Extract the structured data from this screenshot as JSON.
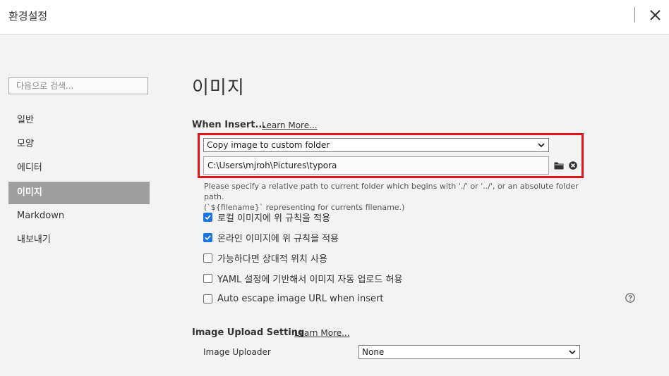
{
  "window": {
    "title": "환경설정"
  },
  "sidebar": {
    "search_placeholder": "다음으로 검색...",
    "items": [
      {
        "label": "일반",
        "active": false
      },
      {
        "label": "모양",
        "active": false
      },
      {
        "label": "에디터",
        "active": false
      },
      {
        "label": "이미지",
        "active": true
      },
      {
        "label": "Markdown",
        "active": false
      },
      {
        "label": "내보내기",
        "active": false
      }
    ]
  },
  "main": {
    "title": "이미지",
    "when_insert": {
      "label": "When Insert...",
      "learn_more": "Learn More...",
      "select_value": "Copy image to custom folder",
      "path_value": "C:\\Users\\mjroh\\Pictures\\typora",
      "hint_line1": "Please specify a relative path to current folder which begins with './' or '../', or an absolute folder path.",
      "hint_line2": "(`${filename}` representing for currents filename.)"
    },
    "options": [
      {
        "label": "로컬 이미지에 위 규칙을 적용",
        "checked": true
      },
      {
        "label": "온라인 이미지에 위 규칙을 적용",
        "checked": true
      },
      {
        "label": "가능하다면 상대적 위치 사용",
        "checked": false
      },
      {
        "label": "YAML 설정에 기반해서 이미지 자동 업로드 허용",
        "checked": false
      },
      {
        "label": "Auto escape image URL when insert",
        "checked": false
      }
    ],
    "upload": {
      "label": "Image Upload Setting",
      "learn_more": "Learn More...",
      "uploader_label": "Image Uploader",
      "uploader_value": "None"
    }
  },
  "colors": {
    "highlight": "#e3141a",
    "checkbox_checked": "#1a73e8",
    "nav_active_bg": "#9e9e9e"
  },
  "icons": [
    "close-icon",
    "chevron-down-icon",
    "folder-icon",
    "clear-icon",
    "check-icon",
    "help-icon"
  ]
}
